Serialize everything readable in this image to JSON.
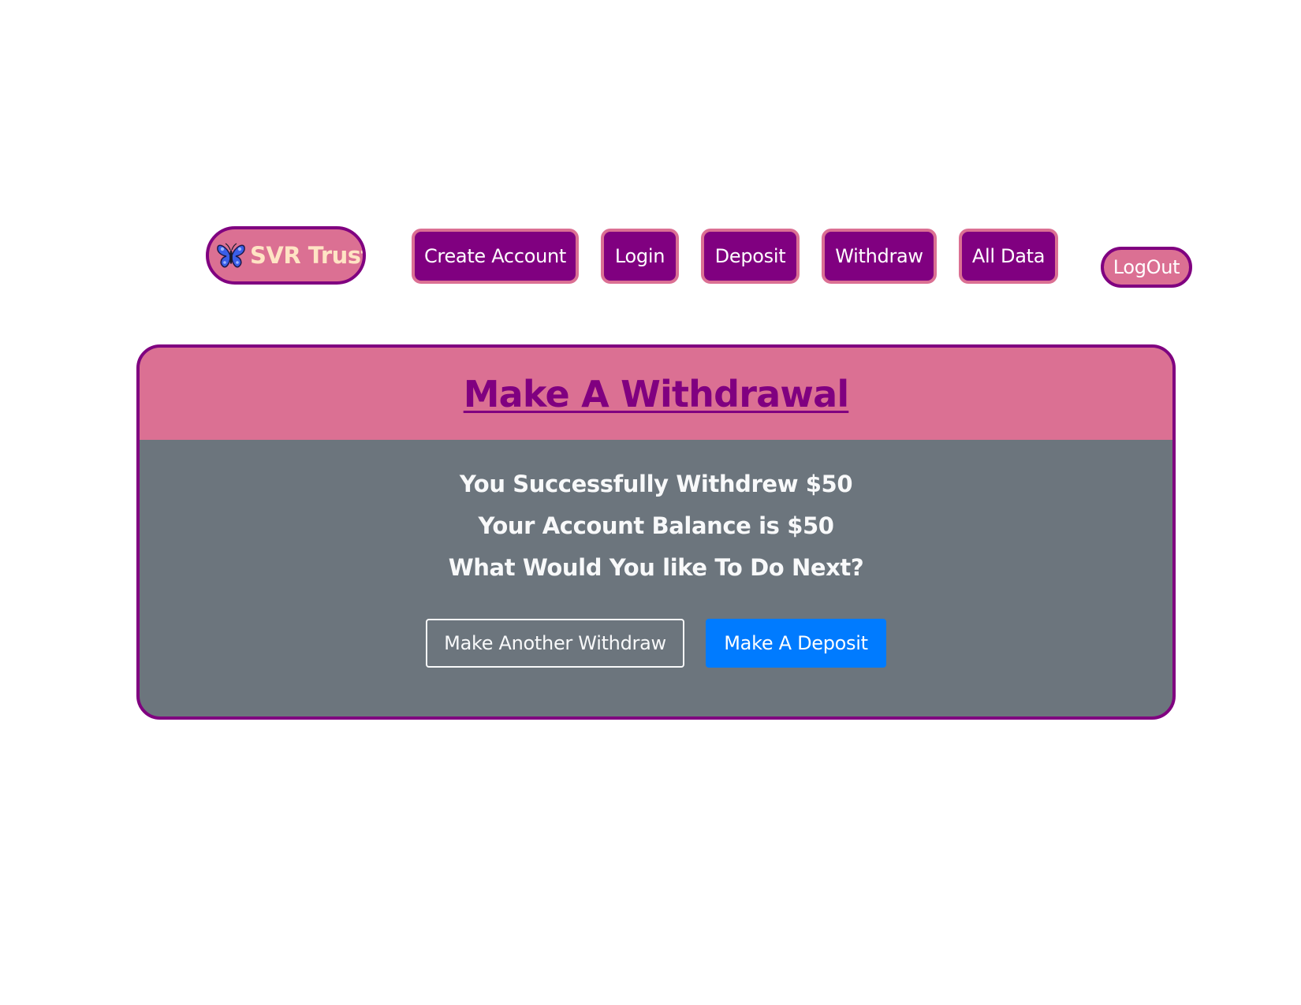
{
  "nav": {
    "brand": {
      "label": "SVR Trust",
      "icon": "butterfly-icon"
    },
    "items": [
      {
        "label": "Create Account"
      },
      {
        "label": "Login"
      },
      {
        "label": "Deposit"
      },
      {
        "label": "Withdraw"
      },
      {
        "label": "All Data"
      }
    ],
    "logout_label": "LogOut"
  },
  "card": {
    "title": "Make A Withdrawal",
    "messages": [
      "You Successfully Withdrew $50",
      "Your Account Balance is $50",
      "What Would You like To Do Next?"
    ],
    "buttons": {
      "another_withdraw": "Make Another Withdraw",
      "make_deposit": "Make A Deposit"
    }
  },
  "colors": {
    "nav_button_bg": "#800080",
    "nav_button_border": "#db7093",
    "brand_bg": "#db7093",
    "brand_text": "#ffe4c4",
    "card_header_bg": "#db7093",
    "card_body_bg": "#6c757d",
    "card_border": "#800080",
    "title_color": "#800080",
    "primary_button": "#007bff"
  }
}
